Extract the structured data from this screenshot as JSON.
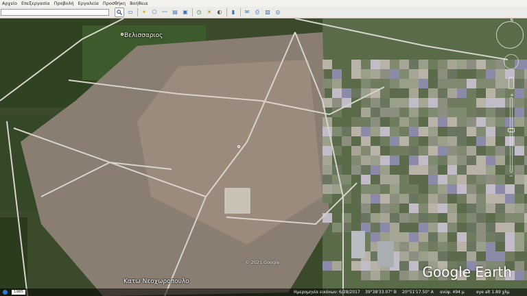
{
  "menu": {
    "items": [
      {
        "label": "Αρχείο"
      },
      {
        "label": "Επεξεργασία"
      },
      {
        "label": "Προβολή"
      },
      {
        "label": "Εργαλεία"
      },
      {
        "label": "Προσθήκη"
      },
      {
        "label": "Βοήθεια"
      }
    ]
  },
  "toolbar": {
    "search": {
      "value": "",
      "placeholder": ""
    },
    "search_icon": "magnifier-icon",
    "buttons": [
      {
        "icon": "sidebar-toggle-icon",
        "symbol": "▭",
        "color": "#3b6fb6"
      },
      {
        "icon": "add-placemark-icon",
        "symbol": "✦",
        "color": "#d9b400"
      },
      {
        "icon": "add-polygon-icon",
        "symbol": "⬠",
        "color": "#3b6fb6"
      },
      {
        "icon": "add-path-icon",
        "symbol": "〰",
        "color": "#3b6fb6"
      },
      {
        "icon": "add-overlay-icon",
        "symbol": "▤",
        "color": "#3b6fb6"
      },
      {
        "icon": "record-tour-icon",
        "symbol": "▣",
        "color": "#3b6fb6"
      },
      {
        "icon": "historical-imagery-icon",
        "symbol": "◷",
        "color": "#2c8a3a"
      },
      {
        "icon": "sunlight-icon",
        "symbol": "☀",
        "color": "#cc8a00"
      },
      {
        "icon": "sky-switch-icon",
        "symbol": "◐",
        "color": "#555"
      },
      {
        "icon": "ruler-icon",
        "symbol": "▮",
        "color": "#3b6fb6"
      },
      {
        "icon": "email-icon",
        "symbol": "✉",
        "color": "#3b6fb6"
      },
      {
        "icon": "print-icon",
        "symbol": "⎙",
        "color": "#3b6fb6"
      },
      {
        "icon": "save-image-icon",
        "symbol": "▧",
        "color": "#3b6fb6"
      },
      {
        "icon": "view-in-maps-icon",
        "symbol": "◎",
        "color": "#3b6fb6"
      }
    ]
  },
  "map": {
    "labels": [
      {
        "text": "Βελισσαριος"
      },
      {
        "text": "Κατω Νεοχωροπουλο"
      }
    ],
    "copyright": "© 2021 Google",
    "brand": "Google Earth"
  },
  "status": {
    "year": "1985",
    "imagery_date": "Ημερομηνία εικόνων: 6/28/2017",
    "lat": "39°38'33.07\" B",
    "lon": "20°51'17.50\" A",
    "elevation": "ανύψ. 494 μ",
    "eye_alt": "eye alt  1.89 χλμ"
  },
  "colors": {
    "accent": "#2a7bd4"
  }
}
